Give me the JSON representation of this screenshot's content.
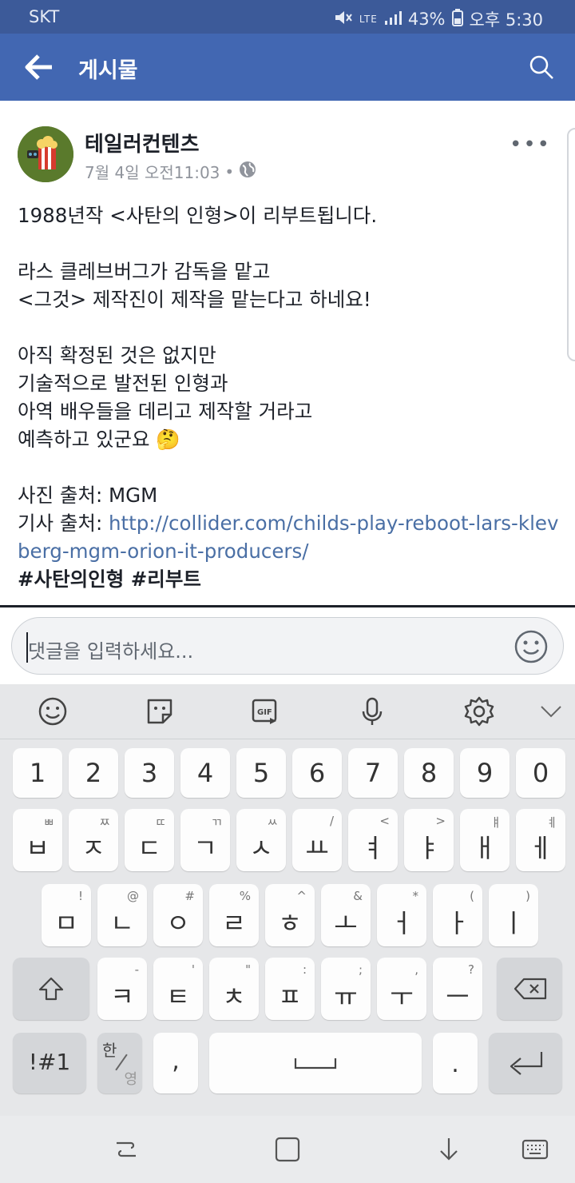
{
  "status_bar": {
    "carrier": "SKT",
    "network": "LTE",
    "battery": "43%",
    "time": "오후 5:30"
  },
  "header": {
    "title": "게시물"
  },
  "post": {
    "author": "테일러컨텐츠",
    "date": "7월 4일 오전11:03",
    "separator": "•",
    "lines": {
      "l1": "1988년작 <사탄의 인형>이 리부트됩니다.",
      "l2": "라스 클레브버그가 감독을 맡고",
      "l3": "<그것> 제작진이 제작을 맡는다고 하네요!",
      "l4": "아직 확정된 것은 없지만",
      "l5": "기술적으로 발전된 인형과",
      "l6": "아역 배우들을 데리고 제작할 거라고",
      "l7": "예측하고 있군요 🤔",
      "l8": "사진 출처: MGM",
      "l9_label": "기사 출처: ",
      "l9_link": "http://collider.com/childs-play-reboot-lars-klevberg-mgm-orion-it-producers/",
      "tags": "#사탄의인형 #리부트"
    }
  },
  "comment": {
    "placeholder": "댓글을 입력하세요..."
  },
  "keyboard": {
    "number_row": [
      "1",
      "2",
      "3",
      "4",
      "5",
      "6",
      "7",
      "8",
      "9",
      "0"
    ],
    "row1": [
      {
        "main": "ㅂ",
        "sub": "ㅃ"
      },
      {
        "main": "ㅈ",
        "sub": "ㅉ"
      },
      {
        "main": "ㄷ",
        "sub": "ㄸ"
      },
      {
        "main": "ㄱ",
        "sub": "ㄲ"
      },
      {
        "main": "ㅅ",
        "sub": "ㅆ"
      },
      {
        "main": "ㅛ",
        "sub": "/"
      },
      {
        "main": "ㅕ",
        "sub": "<"
      },
      {
        "main": "ㅑ",
        "sub": ">"
      },
      {
        "main": "ㅐ",
        "sub": "ㅒ"
      },
      {
        "main": "ㅔ",
        "sub": "ㅖ"
      }
    ],
    "row2": [
      {
        "main": "ㅁ",
        "sub": "!"
      },
      {
        "main": "ㄴ",
        "sub": "@"
      },
      {
        "main": "ㅇ",
        "sub": "#"
      },
      {
        "main": "ㄹ",
        "sub": "%"
      },
      {
        "main": "ㅎ",
        "sub": "^"
      },
      {
        "main": "ㅗ",
        "sub": "&"
      },
      {
        "main": "ㅓ",
        "sub": "*"
      },
      {
        "main": "ㅏ",
        "sub": "("
      },
      {
        "main": "ㅣ",
        "sub": ")"
      }
    ],
    "row3": [
      {
        "main": "ㅋ",
        "sub": "-"
      },
      {
        "main": "ㅌ",
        "sub": "'"
      },
      {
        "main": "ㅊ",
        "sub": "\""
      },
      {
        "main": "ㅍ",
        "sub": ":"
      },
      {
        "main": "ㅠ",
        "sub": ";"
      },
      {
        "main": "ㅜ",
        "sub": ","
      },
      {
        "main": "ㅡ",
        "sub": "?"
      }
    ],
    "symbols_label": "!#1",
    "lang_top": "한",
    "lang_bottom": "영",
    "comma": ",",
    "period": "."
  }
}
